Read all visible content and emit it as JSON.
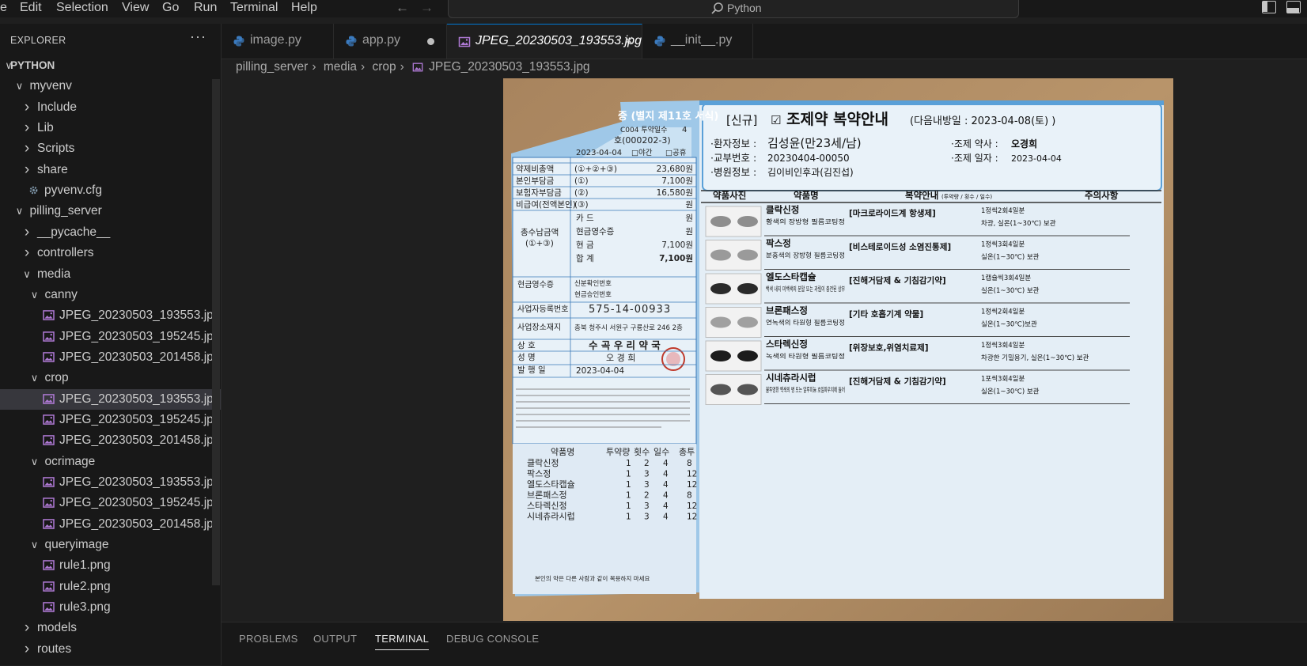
{
  "menu": {
    "items": [
      "e",
      "Edit",
      "Selection",
      "View",
      "Go",
      "Run",
      "Terminal",
      "Help"
    ]
  },
  "search": {
    "text": "Python"
  },
  "sidebar": {
    "title": "EXPLORER",
    "more": "···",
    "tree": [
      {
        "label": "PYTHON",
        "kind": "root",
        "expanded": true
      },
      {
        "label": "myvenv",
        "kind": "folder",
        "expanded": true
      },
      {
        "label": "Include",
        "kind": "folder",
        "expanded": false
      },
      {
        "label": "Lib",
        "kind": "folder",
        "expanded": false
      },
      {
        "label": "Scripts",
        "kind": "folder",
        "expanded": false
      },
      {
        "label": "share",
        "kind": "folder",
        "expanded": false
      },
      {
        "label": "pyvenv.cfg",
        "kind": "gear"
      },
      {
        "label": "pilling_server",
        "kind": "folder",
        "expanded": true
      },
      {
        "label": "__pycache__",
        "kind": "folder",
        "expanded": false
      },
      {
        "label": "controllers",
        "kind": "folder",
        "expanded": false
      },
      {
        "label": "media",
        "kind": "folder",
        "expanded": true
      },
      {
        "label": "canny",
        "kind": "folder",
        "expanded": true
      },
      {
        "label": "JPEG_20230503_193553.jpg",
        "kind": "image"
      },
      {
        "label": "JPEG_20230503_195245.jpg",
        "kind": "image"
      },
      {
        "label": "JPEG_20230503_201458.jpg",
        "kind": "image"
      },
      {
        "label": "crop",
        "kind": "folder",
        "expanded": true
      },
      {
        "label": "JPEG_20230503_193553.jpg",
        "kind": "image",
        "selected": true
      },
      {
        "label": "JPEG_20230503_195245.jpg",
        "kind": "image"
      },
      {
        "label": "JPEG_20230503_201458.jpg",
        "kind": "image"
      },
      {
        "label": "ocrimage",
        "kind": "folder",
        "expanded": true
      },
      {
        "label": "JPEG_20230503_193553.jpg",
        "kind": "image"
      },
      {
        "label": "JPEG_20230503_195245.jpg",
        "kind": "image"
      },
      {
        "label": "JPEG_20230503_201458.jpg",
        "kind": "image"
      },
      {
        "label": "queryimage",
        "kind": "folder",
        "expanded": true
      },
      {
        "label": "rule1.png",
        "kind": "image"
      },
      {
        "label": "rule2.png",
        "kind": "image"
      },
      {
        "label": "rule3.png",
        "kind": "image"
      },
      {
        "label": "models",
        "kind": "folder",
        "expanded": false
      },
      {
        "label": "routes",
        "kind": "folder",
        "expanded": false
      }
    ]
  },
  "tabs": [
    {
      "label": "image.py",
      "icon": "python-icon"
    },
    {
      "label": "app.py",
      "icon": "python-icon",
      "modified": true
    },
    {
      "label": "JPEG_20230503_193553.jpg",
      "icon": "image-file-icon",
      "active": true
    },
    {
      "label": "__init__.py",
      "icon": "python-icon"
    }
  ],
  "breadcrumb": {
    "items": [
      "pilling_server",
      "media",
      "crop",
      "JPEG_20230503_193553.jpg"
    ]
  },
  "receipt": {
    "header_top": "증 (별지 제11호 서식)",
    "days_label": "C004 투약일수",
    "days_value": "4",
    "doc_no": "호(000202-3)",
    "date_row": "2023-04-04",
    "night_label": "□야간",
    "holiday_label": "□공휴",
    "rows": [
      {
        "label": "약제비총액",
        "mid": "(①+②+③)",
        "value": "23,680원"
      },
      {
        "label": "본인부담금",
        "mid": "(①)",
        "value": "7,100원"
      },
      {
        "label": "보험자부담금",
        "mid": "(②)",
        "value": "16,580원"
      },
      {
        "label": "비급여(전액본인)",
        "mid": "(③)",
        "value": "원"
      }
    ],
    "pay_label": "총수납금액",
    "pay_sub": "(①+③)",
    "pay_rows": [
      {
        "label": "카      드",
        "value": "원"
      },
      {
        "label": "현금영수증",
        "value": "원"
      },
      {
        "label": "현      금",
        "value": "7,100원"
      },
      {
        "label": "합      계",
        "value": "7,100원"
      }
    ],
    "cash_label": "현금영수증",
    "cash_sub1": "신분확인번호",
    "cash_sub2": "현금승인번호",
    "biz_no_label": "사업자등록번호",
    "biz_no": "575-14-00933",
    "addr_label": "사업장소재지",
    "addr": "충북 청주시 서원구 구룡산로 246 2층",
    "shop_label": "상      호",
    "shop": "수 곡 우 리 약 국",
    "name_label": "성      명",
    "name": "오 경 희",
    "issue_label": "발  행  일",
    "issue": "2023-04-04",
    "med_header": [
      "약품명",
      "투약량",
      "횟수",
      "일수",
      "총투"
    ],
    "meds": [
      {
        "name": "클락신정",
        "a": "1",
        "b": "2",
        "c": "4",
        "d": "8"
      },
      {
        "name": "팍스정",
        "a": "1",
        "b": "3",
        "c": "4",
        "d": "12"
      },
      {
        "name": "엘도스타캡슐",
        "a": "1",
        "b": "3",
        "c": "4",
        "d": "12"
      },
      {
        "name": "브론패스정",
        "a": "1",
        "b": "2",
        "c": "4",
        "d": "8"
      },
      {
        "name": "스타렉신정",
        "a": "1",
        "b": "3",
        "c": "4",
        "d": "12"
      },
      {
        "name": "시네츄라시럽",
        "a": "1",
        "b": "3",
        "c": "4",
        "d": "12"
      }
    ],
    "foot_note": "본인의 약은 다른 사람과 같이 복용하지 마세요"
  },
  "guide": {
    "title_prefix": "[신규]",
    "title": "조제약 복약안내",
    "next_visit": "(다음내방일 :  2023-04-08(토)     )",
    "patient_label": "·환자정보 :",
    "patient": "김성윤(만23세/남)",
    "issue_no_label": "·교부번호 :",
    "issue_no": "20230404-00050",
    "hospital_label": "·병원정보 :",
    "hospital": "김이비인후과(김진섭)",
    "pharmacist_label": "·조제 약사 :",
    "pharmacist": "오경희",
    "date_label": "·조제 일자 :",
    "date": "2023-04-04",
    "col_photo": "약품사진",
    "col_name": "약품명",
    "col_guide": "복약안내",
    "col_guide_sub": "(투약량 / 횟수 / 일수)",
    "col_caution": "주의사항",
    "items": [
      {
        "name": "클락신정",
        "desc": "황색의 장방형 필름코팅정",
        "class": "[마크로라이드계 항생제]",
        "dose": "1정씩2회4일분",
        "note": "차광, 실온(1~30℃) 보관",
        "pill": "#8e8e8e"
      },
      {
        "name": "팍스정",
        "desc": "분홍색의 장방형 필름코팅정",
        "class": "[비스테로이드성 소염진통제]",
        "dose": "1정씩3회4일분",
        "note": "실온(1~30℃) 보관",
        "pill": "#9a9a9a"
      },
      {
        "name": "엘도스타캡슐",
        "desc": "백색 내지 미백색의 분말 또는 과립이 충전된 상부",
        "class": "[진해거담제 & 기침감기약]",
        "dose": "1캡슐씩3회4일분",
        "note": "실온(1~30℃) 보관",
        "pill": "#2a2a2a"
      },
      {
        "name": "브론패스정",
        "desc": "연녹색의 타원형 필름코팅정",
        "class": "[기타 호흡기계 약물]",
        "dose": "1정씩2회4일분",
        "note": "실온(1~30℃)보관",
        "pill": "#a0a0a0"
      },
      {
        "name": "스타렉신정",
        "desc": "녹색의 타원형 필름코팅정",
        "class": "[위장보호,위염치료제]",
        "dose": "1정씩3회4일분",
        "note": "차광한 기밀용기, 실온(1~30℃) 보관",
        "pill": "#1c1c1c"
      },
      {
        "name": "시네츄라시럽",
        "desc": "불투명한 백색의 병 또는 알루미늄 호일파우치에 들어",
        "class": "[진해거담제 & 기침감기약]",
        "dose": "1포씩3회4일분",
        "note": "실온(1~30℃) 보관",
        "pill": "#555555"
      }
    ]
  },
  "panel": {
    "tabs": [
      "PROBLEMS",
      "OUTPUT",
      "TERMINAL",
      "DEBUG CONSOLE"
    ],
    "active": "TERMINAL"
  }
}
